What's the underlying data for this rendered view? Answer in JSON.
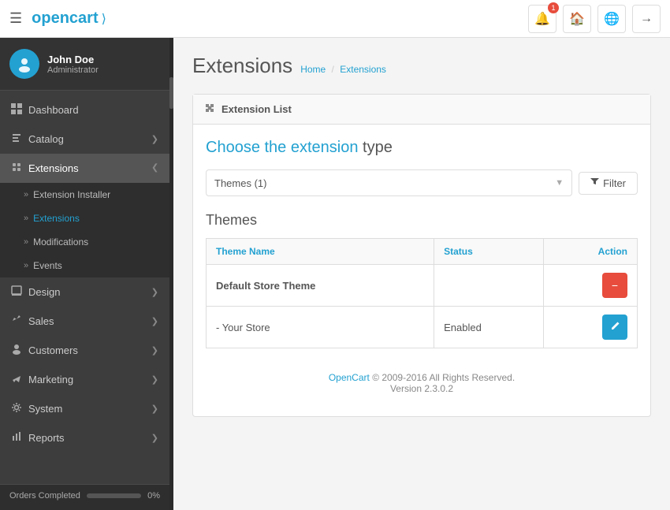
{
  "navbar": {
    "hamburger_label": "☰",
    "logo_text": "opencart",
    "logo_cart": "🛒",
    "notification_count": "1",
    "icons": {
      "bell": "🔔",
      "home": "🏠",
      "globe": "🌐",
      "logout": "→"
    }
  },
  "sidebar": {
    "user": {
      "name": "John Doe",
      "role": "Administrator",
      "avatar": "👤"
    },
    "items": [
      {
        "id": "dashboard",
        "label": "Dashboard",
        "icon": "📊",
        "has_chevron": false
      },
      {
        "id": "catalog",
        "label": "Catalog",
        "icon": "🏷",
        "has_chevron": true
      },
      {
        "id": "extensions",
        "label": "Extensions",
        "icon": "🧩",
        "has_chevron": true,
        "open": true
      },
      {
        "id": "design",
        "label": "Design",
        "icon": "🖥",
        "has_chevron": true
      },
      {
        "id": "sales",
        "label": "Sales",
        "icon": "🛒",
        "has_chevron": true
      },
      {
        "id": "customers",
        "label": "Customers",
        "icon": "👤",
        "has_chevron": true
      },
      {
        "id": "marketing",
        "label": "Marketing",
        "icon": "📢",
        "has_chevron": true
      },
      {
        "id": "system",
        "label": "System",
        "icon": "⚙",
        "has_chevron": true
      },
      {
        "id": "reports",
        "label": "Reports",
        "icon": "📊",
        "has_chevron": true
      }
    ],
    "subitems": [
      {
        "id": "extension-installer",
        "label": "Extension Installer"
      },
      {
        "id": "extensions-sub",
        "label": "Extensions",
        "active": true
      },
      {
        "id": "modifications",
        "label": "Modifications"
      },
      {
        "id": "events",
        "label": "Events"
      }
    ],
    "progress": {
      "label": "Orders Completed",
      "percent": "0%",
      "value": 0
    }
  },
  "page": {
    "title": "Extensions",
    "breadcrumb": {
      "home": "Home",
      "current": "Extensions",
      "separator": "/"
    }
  },
  "card": {
    "header": "Extension List",
    "section_title_1": "Choose the extension",
    "section_title_2": "type",
    "filter": {
      "select_value": "Themes (1)",
      "button_label": "Filter"
    },
    "themes_title": "Themes",
    "table": {
      "columns": [
        {
          "key": "theme_name",
          "label": "Theme Name"
        },
        {
          "key": "status",
          "label": "Status"
        },
        {
          "key": "action",
          "label": "Action"
        }
      ],
      "rows": [
        {
          "theme_name": "Default Store Theme",
          "status": "",
          "action_type": "delete"
        },
        {
          "theme_name": "- Your Store",
          "status": "Enabled",
          "action_type": "edit"
        }
      ]
    }
  },
  "footer": {
    "text": "OpenCart © 2009-2016 All Rights Reserved.",
    "version": "Version 2.3.0.2",
    "link_text": "OpenCart"
  }
}
